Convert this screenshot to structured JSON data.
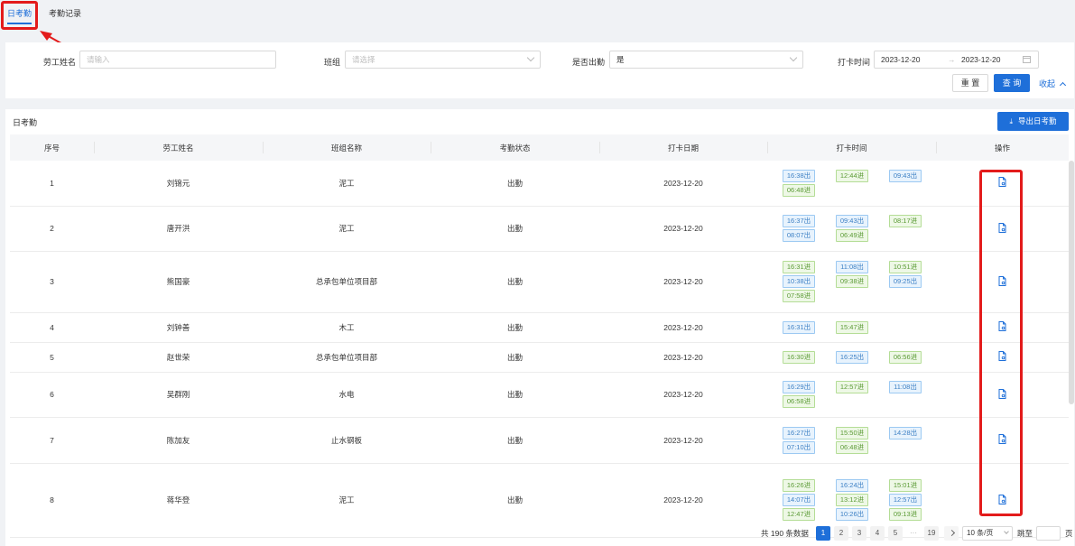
{
  "tabs": [
    {
      "label": "日考勤",
      "active": true
    },
    {
      "label": "考勤记录",
      "active": false
    }
  ],
  "filter": {
    "worker_name_label": "劳工姓名",
    "worker_name_placeholder": "请输入",
    "team_label": "班组",
    "team_placeholder": "请选择",
    "attend_label": "是否出勤",
    "attend_value": "是",
    "time_label": "打卡时间",
    "date_start": "2023-12-20",
    "date_sep": "→",
    "date_end": "2023-12-20",
    "reset_label": "重 置",
    "query_label": "查 询",
    "collapse_label": "收起"
  },
  "panel": {
    "title": "日考勤",
    "export_label": "导出日考勤"
  },
  "table": {
    "headers": [
      "序号",
      "劳工姓名",
      "班组名称",
      "考勤状态",
      "打卡日期",
      "打卡时间",
      "操作"
    ],
    "rows": [
      {
        "no": "1",
        "name": "刘锦元",
        "team": "泥工",
        "status": "出勤",
        "date": "2023-12-20",
        "times": [
          {
            "t": "16:38出",
            "k": "out"
          },
          {
            "t": "12:44进",
            "k": "in"
          },
          {
            "t": "09:43出",
            "k": "out"
          },
          {
            "t": "06:48进",
            "k": "in"
          }
        ]
      },
      {
        "no": "2",
        "name": "唐开洪",
        "team": "泥工",
        "status": "出勤",
        "date": "2023-12-20",
        "times": [
          {
            "t": "16:37出",
            "k": "out"
          },
          {
            "t": "09:43出",
            "k": "out"
          },
          {
            "t": "08:17进",
            "k": "in"
          },
          {
            "t": "08:07出",
            "k": "out"
          },
          {
            "t": "06:49进",
            "k": "in"
          }
        ]
      },
      {
        "no": "3",
        "name": "熊国豪",
        "team": "总承包单位项目部",
        "status": "出勤",
        "date": "2023-12-20",
        "times": [
          {
            "t": "16:31进",
            "k": "in"
          },
          {
            "t": "11:08出",
            "k": "out"
          },
          {
            "t": "10:51进",
            "k": "in"
          },
          {
            "t": "10:38出",
            "k": "out"
          },
          {
            "t": "09:38进",
            "k": "in"
          },
          {
            "t": "09:25出",
            "k": "out"
          },
          {
            "t": "07:58进",
            "k": "in"
          }
        ]
      },
      {
        "no": "4",
        "name": "刘钟善",
        "team": "木工",
        "status": "出勤",
        "date": "2023-12-20",
        "times": [
          {
            "t": "16:31出",
            "k": "out"
          },
          {
            "t": "15:47进",
            "k": "in"
          }
        ]
      },
      {
        "no": "5",
        "name": "赵世荣",
        "team": "总承包单位项目部",
        "status": "出勤",
        "date": "2023-12-20",
        "times": [
          {
            "t": "16:30进",
            "k": "in"
          },
          {
            "t": "16:25出",
            "k": "out"
          },
          {
            "t": "06:56进",
            "k": "in"
          }
        ]
      },
      {
        "no": "6",
        "name": "吴群刚",
        "team": "水电",
        "status": "出勤",
        "date": "2023-12-20",
        "times": [
          {
            "t": "16:29出",
            "k": "out"
          },
          {
            "t": "12:57进",
            "k": "in"
          },
          {
            "t": "11:08出",
            "k": "out"
          },
          {
            "t": "06:58进",
            "k": "in"
          }
        ]
      },
      {
        "no": "7",
        "name": "陈加友",
        "team": "止水钢板",
        "status": "出勤",
        "date": "2023-12-20",
        "times": [
          {
            "t": "16:27出",
            "k": "out"
          },
          {
            "t": "15:50进",
            "k": "in"
          },
          {
            "t": "14:28出",
            "k": "out"
          },
          {
            "t": "07:10出",
            "k": "out"
          },
          {
            "t": "06:48进",
            "k": "in"
          }
        ]
      },
      {
        "no": "8",
        "name": "蒋华登",
        "team": "泥工",
        "status": "出勤",
        "date": "2023-12-20",
        "times": [
          {
            "t": "16:26进",
            "k": "in"
          },
          {
            "t": "16:24出",
            "k": "out"
          },
          {
            "t": "15:01进",
            "k": "in"
          },
          {
            "t": "14:07出",
            "k": "out"
          },
          {
            "t": "13:12进",
            "k": "in"
          },
          {
            "t": "12:57出",
            "k": "out"
          },
          {
            "t": "12:47进",
            "k": "in"
          },
          {
            "t": "10:26出",
            "k": "out"
          },
          {
            "t": "09:13进",
            "k": "in"
          }
        ]
      }
    ]
  },
  "pagination": {
    "total_text": "共 190 条数据",
    "pages": [
      "1",
      "2",
      "3",
      "4",
      "5"
    ],
    "ellipsis": "···",
    "last_page": "19",
    "page_size": "10 条/页",
    "jump_label": "跳至",
    "page_suffix": "页"
  },
  "colors": {
    "primary": "#1e6fd9",
    "highlight": "#e31b1b",
    "tag_out": "#3b7fc4",
    "tag_in": "#5a9a34"
  },
  "icons": {
    "detail": "document-icon",
    "export": "download-icon",
    "calendar": "calendar-icon"
  }
}
